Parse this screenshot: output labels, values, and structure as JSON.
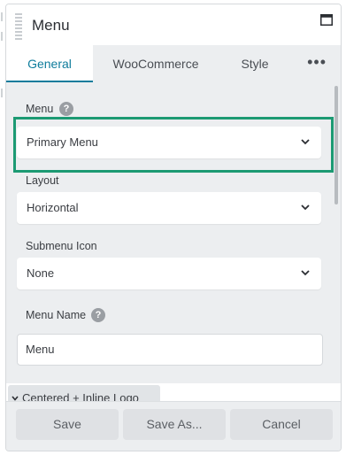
{
  "header": {
    "title": "Menu",
    "icon": "maximize-icon"
  },
  "tabs": [
    {
      "label": "General",
      "active": true
    },
    {
      "label": "WooCommerce",
      "active": false
    },
    {
      "label": "Style",
      "active": false
    }
  ],
  "tabs_more": "•••",
  "fields": {
    "menu": {
      "label": "Menu",
      "value": "Primary Menu",
      "help": "?"
    },
    "layout": {
      "label": "Layout",
      "value": "Horizontal"
    },
    "submenu_icon": {
      "label": "Submenu Icon",
      "value": "None"
    },
    "menu_name": {
      "label": "Menu Name",
      "value": "Menu",
      "help": "?"
    }
  },
  "section": {
    "label": "Centered + Inline Logo",
    "icon": "chevron-down-icon"
  },
  "footer": {
    "save": "Save",
    "save_as": "Save As...",
    "cancel": "Cancel"
  },
  "colors": {
    "accent": "#0e7c9c",
    "highlight": "#1c9a73",
    "panel_bg": "#eceef0"
  }
}
